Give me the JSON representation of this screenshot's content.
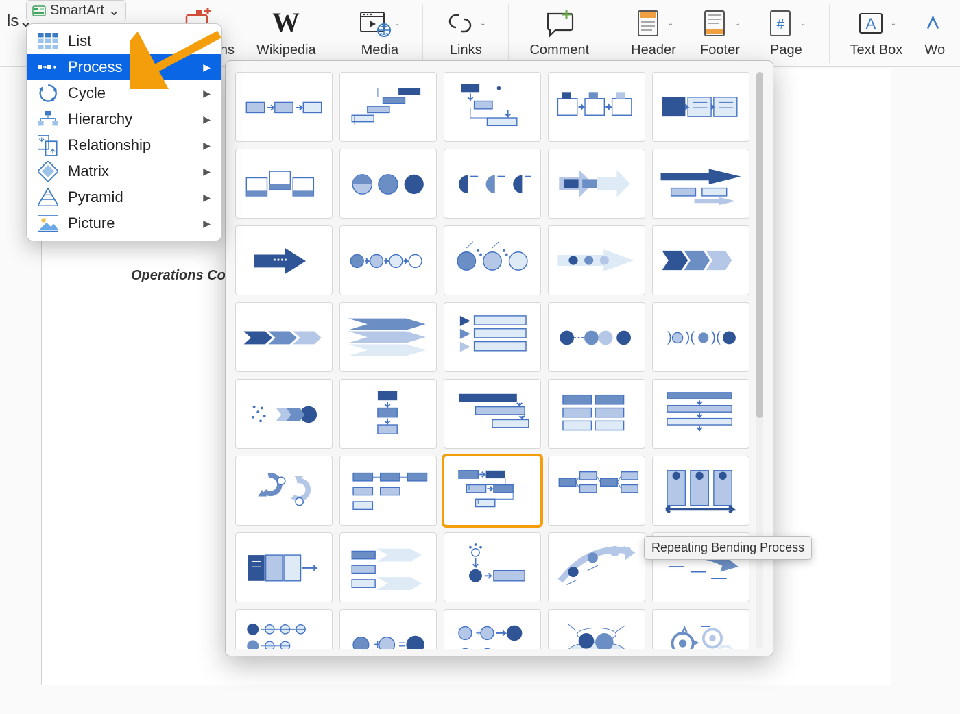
{
  "ribbon": {
    "smartart_button": "SmartArt",
    "addins_label": "Get Add-ins",
    "wikipedia_label": "Wikipedia",
    "media_label": "Media",
    "links_label": "Links",
    "comment_label": "Comment",
    "header_label": "Header",
    "footer_label": "Footer",
    "page_label": "Page",
    "textbox_label": "Text Box",
    "wordart_trunc": "Wo",
    "left_trunc": "ls"
  },
  "menu": {
    "items": [
      {
        "label": "List",
        "icon": "list"
      },
      {
        "label": "Process",
        "icon": "process",
        "selected": true
      },
      {
        "label": "Cycle",
        "icon": "cycle"
      },
      {
        "label": "Hierarchy",
        "icon": "hierarchy"
      },
      {
        "label": "Relationship",
        "icon": "relationship"
      },
      {
        "label": "Matrix",
        "icon": "matrix"
      },
      {
        "label": "Pyramid",
        "icon": "pyramid"
      },
      {
        "label": "Picture",
        "icon": "picture"
      }
    ]
  },
  "gallery": {
    "highlight_index": 27,
    "tooltip": "Repeating Bending Process"
  },
  "document": {
    "visible_text": "Operations Coord"
  }
}
